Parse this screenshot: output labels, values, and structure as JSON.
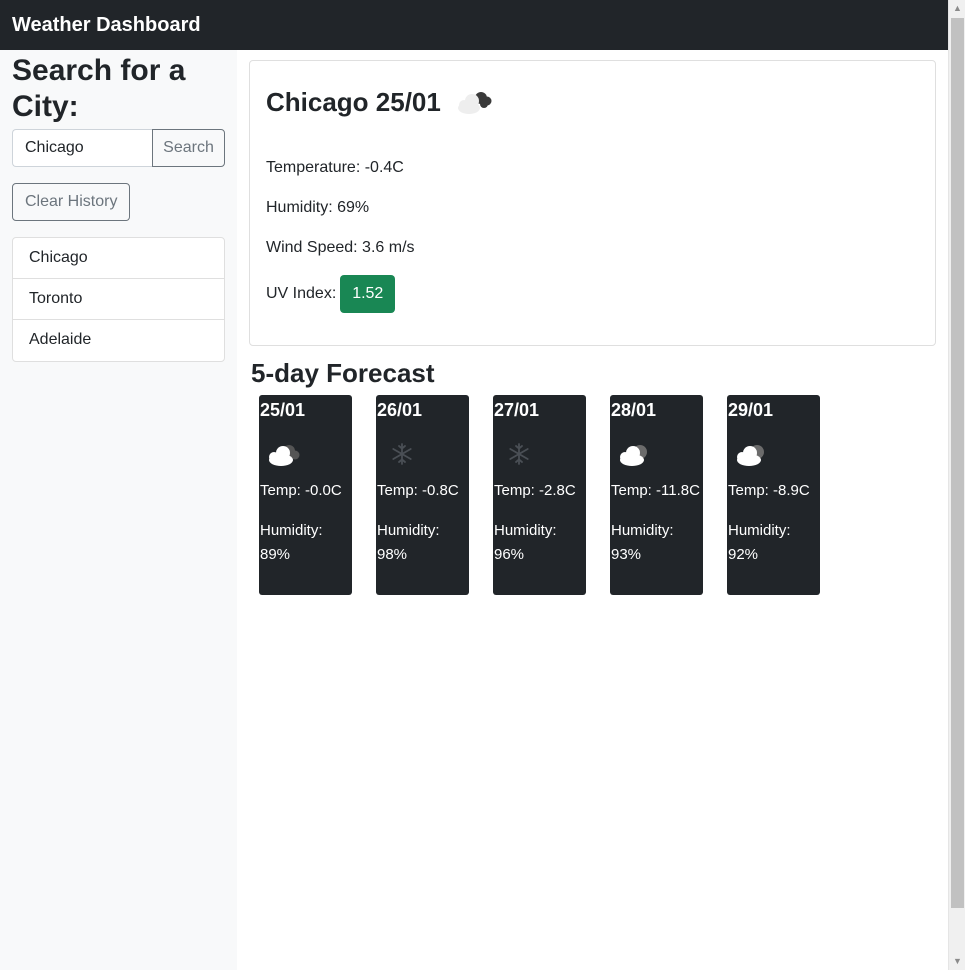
{
  "navbar": {
    "brand": "Weather Dashboard"
  },
  "sidebar": {
    "heading": "Search for a City:",
    "search_value": "Chicago",
    "search_label": "Search",
    "clear_label": "Clear History",
    "history": [
      "Chicago",
      "Toronto",
      "Adelaide"
    ]
  },
  "current": {
    "title": "Chicago 25/01",
    "icon": "broken-clouds-icon",
    "temperature": "Temperature: -0.4C",
    "humidity": "Humidity: 69%",
    "wind": "Wind Speed: 3.6 m/s",
    "uv_label": "UV Index:",
    "uv_value": "1.52",
    "uv_color": "#198754"
  },
  "forecast": {
    "title": "5-day Forecast",
    "days": [
      {
        "date": "25/01",
        "icon": "broken-clouds-icon",
        "temp": "Temp: -0.0C",
        "humidity_label": "Humidity:",
        "humidity": "89%"
      },
      {
        "date": "26/01",
        "icon": "snow-icon",
        "temp": "Temp: -0.8C",
        "humidity_label": "Humidity:",
        "humidity": "98%"
      },
      {
        "date": "27/01",
        "icon": "snow-icon",
        "temp": "Temp: -2.8C",
        "humidity_label": "Humidity:",
        "humidity": "96%"
      },
      {
        "date": "28/01",
        "icon": "cloudy-icon",
        "temp": "Temp: -11.8C",
        "humidity_label": "Humidity:",
        "humidity": "93%"
      },
      {
        "date": "29/01",
        "icon": "cloudy-icon",
        "temp": "Temp: -8.9C",
        "humidity_label": "Humidity:",
        "humidity": "92%"
      }
    ]
  }
}
